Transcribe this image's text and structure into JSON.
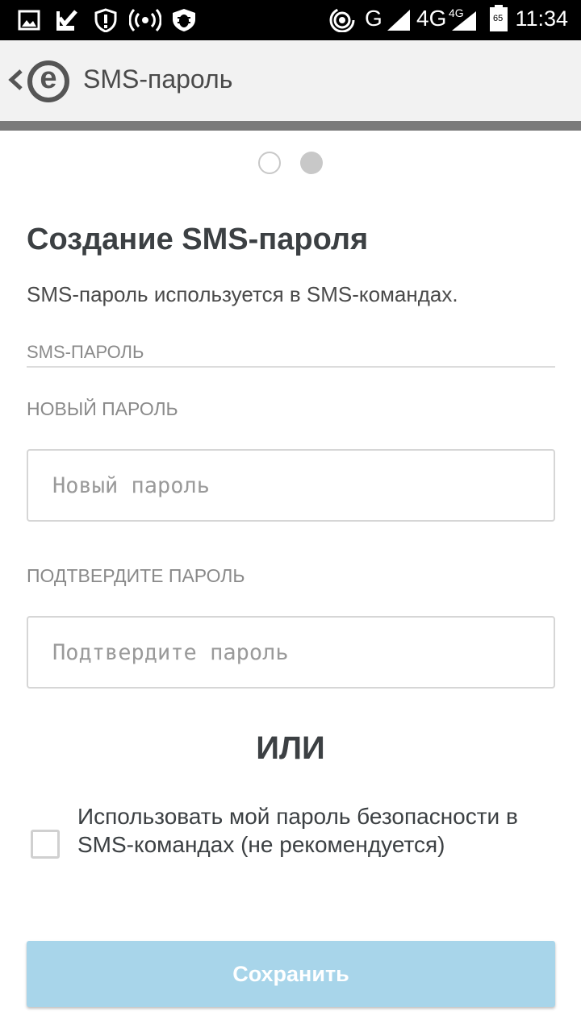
{
  "status_bar": {
    "time": "11:34",
    "network_g": "G",
    "network_4g": "4G",
    "network_4g_small": "4G",
    "battery_level": "65",
    "icons": [
      "image-icon",
      "check-flag-icon",
      "shield-alert-icon",
      "radio-wave-icon",
      "bug-shield-icon",
      "hotspot-icon",
      "signal-icon",
      "battery-icon"
    ]
  },
  "app_bar": {
    "title": "SMS-пароль",
    "logo_letter": "e"
  },
  "pager": {
    "pages": 2,
    "current": 2
  },
  "content": {
    "heading": "Создание SMS-пароля",
    "description": "SMS-пароль используется в SMS-командах.",
    "section_label": "SMS-ПАРОЛЬ",
    "new_password_label": "НОВЫЙ ПАРОЛЬ",
    "new_password_placeholder": "Новый пароль",
    "confirm_password_label": "ПОДТВЕРДИТЕ ПАРОЛЬ",
    "confirm_password_placeholder": "Подтвердите пароль",
    "or_text": "ИЛИ",
    "checkbox_label": "Использовать мой пароль безопасности в SMS-командах (не рекомендуется)",
    "checkbox_checked": false,
    "save_label": "Сохранить"
  },
  "colors": {
    "accent_disabled": "#a8d5ea",
    "progress": "#7a7a7a",
    "app_bar_bg": "#f2f2f2"
  }
}
